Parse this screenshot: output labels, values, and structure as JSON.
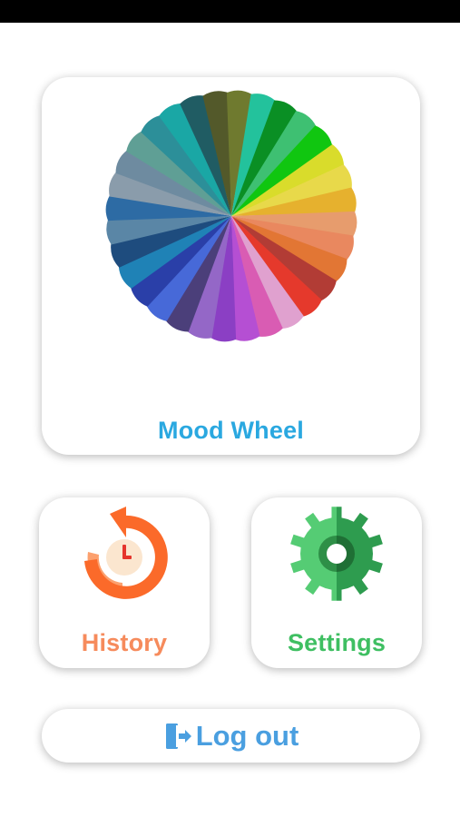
{
  "colors": {
    "mood_label": "#2aa8e0",
    "history_label": "#f68b5c",
    "settings_label": "#3fbf62",
    "logout_label": "#4a9fe0",
    "history_ring": "#fb6a2a",
    "history_ring_light": "#fca06e",
    "history_face": "#fbe6cf",
    "history_hand": "#e5342c",
    "gear_light": "#55cc74",
    "gear_dark": "#2e9c4f",
    "gear_hole_light": "#2e8f47",
    "gear_hole_dark": "#1f6f35"
  },
  "mood_wheel": {
    "label": "Mood Wheel",
    "icon": "color-wheel-icon",
    "segment_colors": [
      "#d9dc2b",
      "#e8d94a",
      "#e6b12e",
      "#e79c6d",
      "#e9885f",
      "#e27634",
      "#b23c35",
      "#e5392c",
      "#e0a1cf",
      "#d95cb3",
      "#b54fd3",
      "#8b3fc4",
      "#9467c7",
      "#4b3f7a",
      "#4769d8",
      "#2a3fa8",
      "#1f82b6",
      "#1e4c7e",
      "#5a86a6",
      "#2d6ba4",
      "#8a9cab",
      "#6e8ba0",
      "#5f9f95",
      "#2c8f99",
      "#1aa7a5",
      "#205c63",
      "#53592a",
      "#6f7a2f",
      "#23c29c",
      "#0a8f24",
      "#3ec072",
      "#10c610"
    ]
  },
  "history": {
    "label": "History",
    "icon": "history-clock-icon"
  },
  "settings": {
    "label": "Settings",
    "icon": "gear-icon"
  },
  "logout": {
    "label": "Log out",
    "icon": "logout-door-icon"
  }
}
